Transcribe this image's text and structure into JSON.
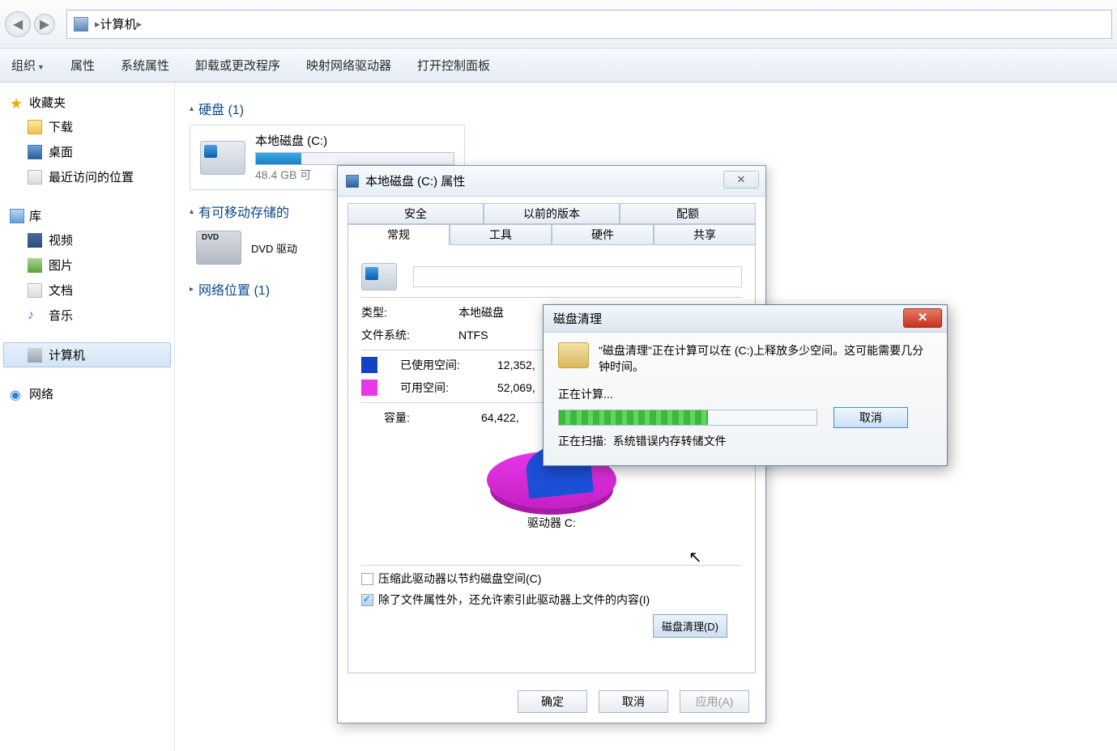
{
  "nav": {
    "location": "计算机"
  },
  "toolbar": {
    "organize": "组织",
    "properties": "属性",
    "sys_props": "系统属性",
    "uninstall": "卸载或更改程序",
    "map_drive": "映射网络驱动器",
    "ctrl_panel": "打开控制面板"
  },
  "sidebar": {
    "fav": "收藏夹",
    "downloads": "下载",
    "desktop": "桌面",
    "recent": "最近访问的位置",
    "lib": "库",
    "video": "视频",
    "pics": "图片",
    "docs": "文档",
    "music": "音乐",
    "computer": "计算机",
    "network": "网络"
  },
  "content": {
    "hdd_group": "硬盘 (1)",
    "removable_group": "有可移动存储的",
    "netloc_group": "网络位置 (1)",
    "local_c": "本地磁盘 (C:)",
    "local_c_sub": "48.4 GB 可",
    "dvd": "DVD 驱动"
  },
  "props": {
    "title": "本地磁盘 (C:) 属性",
    "tab_security": "安全",
    "tab_prev": "以前的版本",
    "tab_quota": "配额",
    "tab_general": "常规",
    "tab_tools": "工具",
    "tab_hw": "硬件",
    "tab_share": "共享",
    "type_lbl": "类型:",
    "type_val": "本地磁盘",
    "fs_lbl": "文件系统:",
    "fs_val": "NTFS",
    "used_lbl": "已使用空间:",
    "used_val": "12,352,",
    "free_lbl": "可用空间:",
    "free_val": "52,069,",
    "cap_lbl": "容量:",
    "cap_val": "64,422,",
    "drive": "驱动器 C:",
    "cleanup_btn": "磁盘清理(D)",
    "compress": "压缩此驱动器以节约磁盘空间(C)",
    "index": "除了文件属性外，还允许索引此驱动器上文件的内容(I)",
    "ok": "确定",
    "cancel": "取消",
    "apply": "应用(A)"
  },
  "cleanup": {
    "title": "磁盘清理",
    "msg": "\"磁盘清理\"正在计算可以在 (C:)上释放多少空间。这可能需要几分钟时间。",
    "calc": "正在计算...",
    "scan_lbl": "正在扫描:",
    "scan_val": "系统错误内存转储文件",
    "cancel": "取消"
  },
  "chart_data": {
    "type": "pie",
    "title": "驱动器 C:",
    "series": [
      {
        "name": "已使用空间",
        "value": 12352,
        "color": "#1343c5"
      },
      {
        "name": "可用空间",
        "value": 52069,
        "color": "#e836e8"
      }
    ]
  }
}
